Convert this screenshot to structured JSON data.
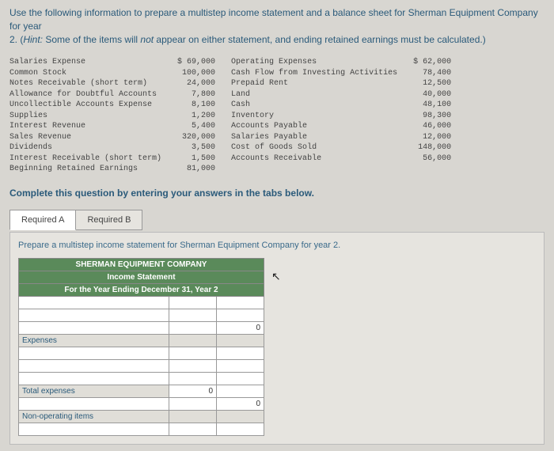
{
  "instructions": {
    "line1": "Use the following information to prepare a multistep income statement and a balance sheet for Sherman Equipment Company for year",
    "line2_prefix": "2. (",
    "line2_hint_label": "Hint:",
    "line2_hint_text": " Some of the items will ",
    "line2_hint_not": "not",
    "line2_hint_rest": " appear on either statement, and ending retained earnings must be calculated.)"
  },
  "accounts": {
    "col1": {
      "labels": [
        "Salaries Expense",
        "Common Stock",
        "Notes Receivable (short term)",
        "Allowance for Doubtful Accounts",
        "Uncollectible Accounts Expense",
        "Supplies",
        "Interest Revenue",
        "Sales Revenue",
        "Dividends",
        "Interest Receivable (short term)",
        "Beginning Retained Earnings"
      ],
      "values": [
        "$ 69,000",
        "100,000",
        "24,000",
        "7,800",
        "8,100",
        "1,200",
        "5,400",
        "320,000",
        "3,500",
        "1,500",
        "81,000"
      ]
    },
    "col2": {
      "labels": [
        "Operating Expenses",
        "Cash Flow from Investing Activities",
        "Prepaid Rent",
        "Land",
        "Cash",
        "Inventory",
        "Accounts Payable",
        "Salaries Payable",
        "Cost of Goods Sold",
        "Accounts Receivable"
      ],
      "values": [
        "$ 62,000",
        "78,400",
        "12,500",
        "40,000",
        "48,100",
        "98,300",
        "46,000",
        "12,000",
        "148,000",
        "56,000"
      ]
    }
  },
  "complete_text": "Complete this question by entering your answers in the tabs below.",
  "tabs": {
    "a": "Required A",
    "b": "Required B"
  },
  "prepare": "Prepare a multistep income statement for Sherman Equipment Company for year 2.",
  "stmt": {
    "h1": "SHERMAN EQUIPMENT COMPANY",
    "h2": "Income Statement",
    "h3": "For the Year Ending December 31, Year 2",
    "expenses_label": "Expenses",
    "total_expenses_label": "Total expenses",
    "nonop_label": "Non-operating items",
    "zero": "0"
  },
  "cursor_glyph": "↖"
}
